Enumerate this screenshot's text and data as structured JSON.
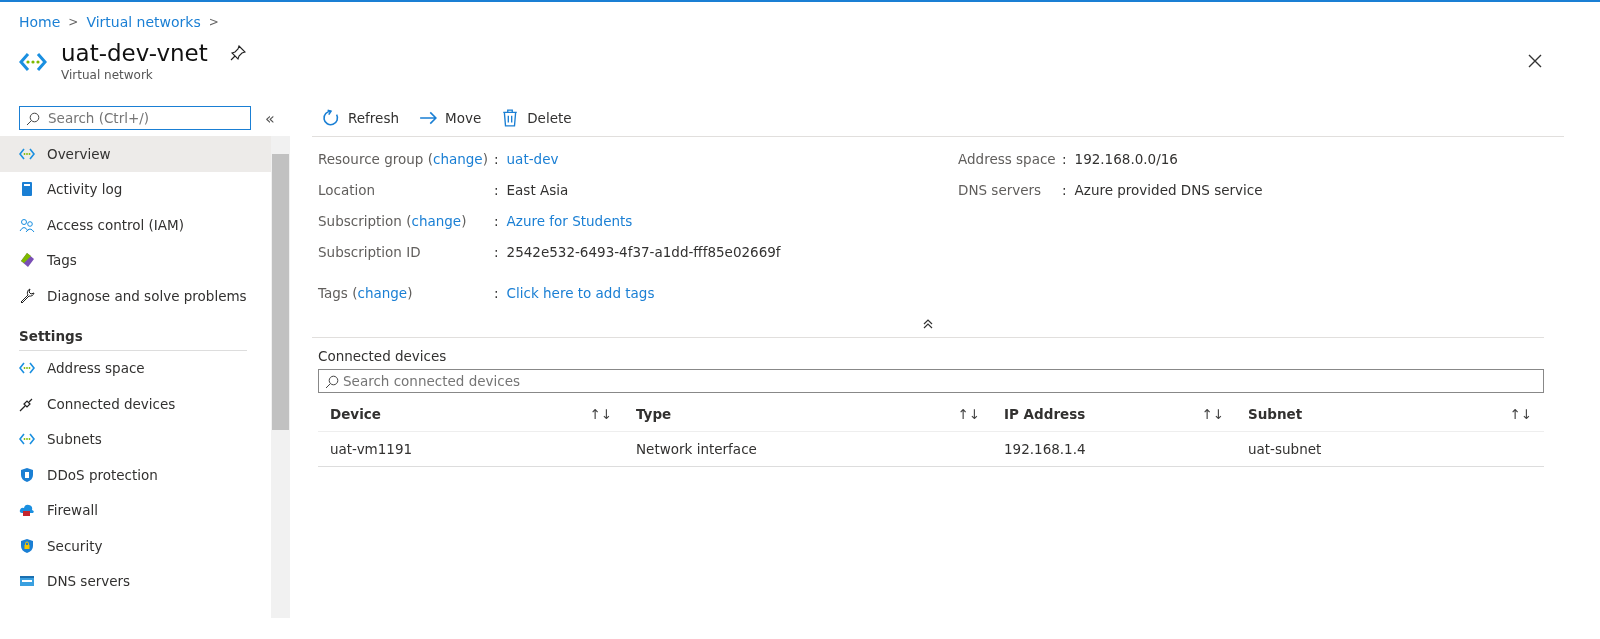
{
  "breadcrumb": [
    {
      "label": "Home"
    },
    {
      "label": "Virtual networks"
    }
  ],
  "breadcrumb_separator": ">",
  "header": {
    "title": "uat-dev-vnet",
    "subtitle": "Virtual network"
  },
  "sidebar": {
    "search": {
      "placeholder": "Search (Ctrl+/)"
    },
    "collapse": "«",
    "items": [
      {
        "label": "Overview",
        "kind": "vnet",
        "selected": true
      },
      {
        "label": "Activity log",
        "kind": "log",
        "selected": false
      },
      {
        "label": "Access control (IAM)",
        "kind": "people",
        "selected": false
      },
      {
        "label": "Tags",
        "kind": "tag",
        "selected": false
      },
      {
        "label": "Diagnose and solve problems",
        "kind": "wrench",
        "selected": false
      }
    ],
    "sections": [
      {
        "title": "Settings",
        "items": [
          {
            "label": "Address space",
            "kind": "vnet",
            "selected": false
          },
          {
            "label": "Connected devices",
            "kind": "plug",
            "selected": false
          },
          {
            "label": "Subnets",
            "kind": "vnet",
            "selected": false
          },
          {
            "label": "DDoS protection",
            "kind": "shield",
            "selected": false
          },
          {
            "label": "Firewall",
            "kind": "cloud",
            "selected": false
          },
          {
            "label": "Security",
            "kind": "lock",
            "selected": false
          },
          {
            "label": "DNS servers",
            "kind": "dns",
            "selected": false
          }
        ]
      }
    ]
  },
  "toolbar": [
    {
      "label": "Refresh",
      "kind": "refresh"
    },
    {
      "label": "Move",
      "kind": "arrow"
    },
    {
      "label": "Delete",
      "kind": "trash"
    }
  ],
  "essentials": {
    "left": [
      {
        "label": "Resource group",
        "link": "change",
        "open": "(",
        "close": ")",
        "sep": ":",
        "value": "uat-dev",
        "kind": "link"
      },
      {
        "label": "Location",
        "sep": ":",
        "value": "East Asia",
        "kind": "text"
      },
      {
        "label": "Subscription",
        "link": "change",
        "open": "(",
        "close": ")",
        "sep": ":",
        "value": "Azure for Students",
        "kind": "link"
      },
      {
        "label": "Subscription ID",
        "sep": ":",
        "value": "2542e532-6493-4f37-a1dd-fff85e02669f",
        "kind": "text"
      },
      {
        "label": "Tags",
        "link": "change",
        "open": "(",
        "close": ")",
        "sep": ":",
        "value": "Click here to add tags",
        "kind": "link"
      }
    ],
    "right": [
      {
        "label": "Address space",
        "sep": ":",
        "value": "192.168.0.0/16",
        "kind": "text"
      },
      {
        "label": "DNS servers",
        "sep": ":",
        "value": "Azure provided DNS service",
        "kind": "text"
      }
    ]
  },
  "connected_devices": {
    "title": "Connected devices",
    "search": {
      "placeholder": "Search connected devices"
    },
    "sort_glyph": "↑↓",
    "columns": [
      "Device",
      "Type",
      "IP Address",
      "Subnet"
    ],
    "rows": [
      [
        "uat-vm1191",
        "Network interface",
        "192.168.1.4",
        "uat-subnet"
      ]
    ]
  }
}
